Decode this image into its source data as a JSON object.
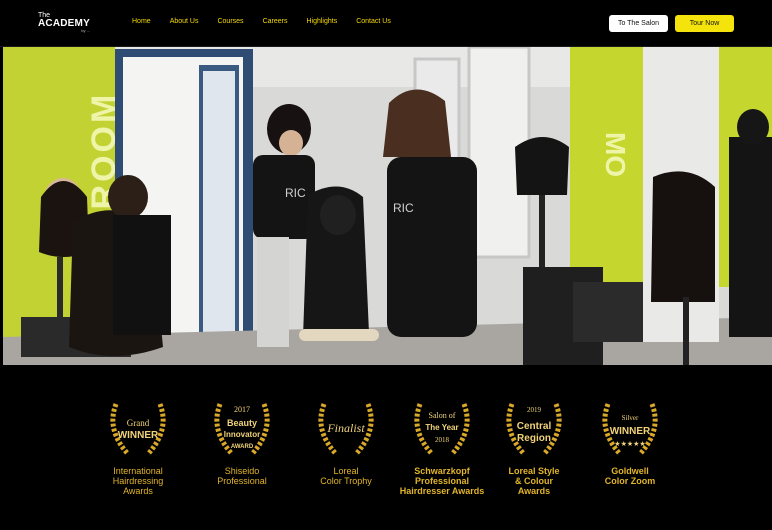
{
  "header": {
    "logo": {
      "line1": "The",
      "line2": "ACADEMY",
      "line3": "by ..."
    },
    "nav": [
      "Home",
      "About Us",
      "Courses",
      "Careers",
      "Highlights",
      "Contact Us"
    ],
    "buttons": {
      "salon": "To The Salon",
      "tour": "Tour Now"
    }
  },
  "hero": {
    "wall_text_left": "Y ROOM",
    "wall_text_right": "MO",
    "shirt_text": "RIC"
  },
  "awards": [
    {
      "badge_top": "",
      "badge_main": "Grand",
      "badge_sub": "WINNER",
      "badge_year": "",
      "caption": [
        "International",
        "Hairdressing",
        "Awards"
      ]
    },
    {
      "badge_top": "2017",
      "badge_main": "Beauty",
      "badge_sub": "Innovator",
      "badge_year": "AWARD",
      "caption": [
        "Shiseido",
        "Professional"
      ]
    },
    {
      "badge_top": "",
      "badge_main": "Finalist",
      "badge_sub": "",
      "badge_year": "",
      "caption": [
        "Loreal",
        "Color Trophy"
      ]
    },
    {
      "badge_top": "Salon of",
      "badge_main": "The Year",
      "badge_sub": "",
      "badge_year": "2018",
      "caption": [
        "Schwarzkopf",
        "Professional",
        "Hairdresser Awards"
      ]
    },
    {
      "badge_top": "2019",
      "badge_main": "Central",
      "badge_sub": "Region",
      "badge_year": "",
      "caption": [
        "Loreal Style",
        "& Colour",
        "Awards"
      ]
    },
    {
      "badge_top": "Silver",
      "badge_main": "WINNER",
      "badge_sub": "",
      "badge_year": "",
      "caption": [
        "Goldwell",
        "Color Zoom"
      ]
    }
  ],
  "colors": {
    "nav": "#f5d90a",
    "gold": "#e2b42a",
    "accent_wall": "#c5d62e"
  }
}
